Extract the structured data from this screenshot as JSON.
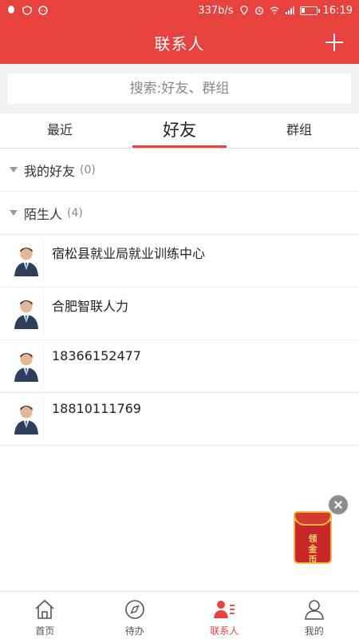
{
  "status_bar": {
    "left_icons": [
      "qq-icon",
      "shield-icon",
      "chat-icon"
    ],
    "network_speed": "337b/s",
    "time": "16:19",
    "right_icons": [
      "location-icon",
      "alarm-icon",
      "wifi-icon",
      "signal-icon",
      "battery-icon"
    ]
  },
  "app_bar": {
    "title": "联系人",
    "add_icon": "plus-icon"
  },
  "search": {
    "placeholder": "搜索:好友、群组"
  },
  "tabs": [
    {
      "label": "最近"
    },
    {
      "label": "好友"
    },
    {
      "label": "群组"
    }
  ],
  "groups": [
    {
      "label": "我的好友",
      "count": "(0)"
    },
    {
      "label": "陌生人",
      "count": "(4)"
    }
  ],
  "contacts": [
    {
      "name": "宿松县就业局就业训练中心"
    },
    {
      "name": "合肥智联人力"
    },
    {
      "name": "18366152477"
    },
    {
      "name": "18810111769"
    }
  ],
  "floating_promo": {
    "text_line1": "领",
    "text_line2": "金",
    "text_line3": "币"
  },
  "bottom_nav": [
    {
      "label": "首页",
      "icon": "home-icon"
    },
    {
      "label": "待办",
      "icon": "compass-icon"
    },
    {
      "label": "联系人",
      "icon": "contacts-icon"
    },
    {
      "label": "我的",
      "icon": "person-icon"
    }
  ],
  "colors": {
    "primary": "#e8423f",
    "background": "#ffffff",
    "search_bg": "#f2f0f0"
  }
}
